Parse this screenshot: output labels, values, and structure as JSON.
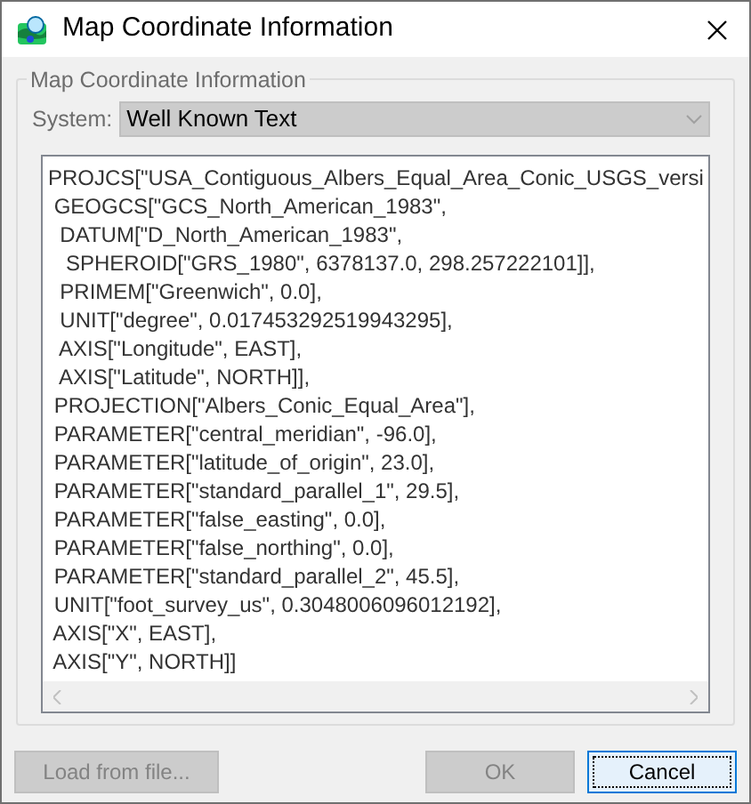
{
  "window": {
    "title": "Map Coordinate Information"
  },
  "group": {
    "title": "Map Coordinate Information"
  },
  "system": {
    "label": "System:",
    "value": "Well Known Text",
    "disabled": true
  },
  "text_lines": [
    "PROJCS[\"USA_Contiguous_Albers_Equal_Area_Conic_USGS_versi",
    " GEOGCS[\"GCS_North_American_1983\",",
    "  DATUM[\"D_North_American_1983\",",
    "   SPHEROID[\"GRS_1980\", 6378137.0, 298.257222101]],",
    "  PRIMEM[\"Greenwich\", 0.0],",
    "  UNIT[\"degree\", 0.017453292519943295],",
    "  AXIS[\"Longitude\", EAST],",
    "  AXIS[\"Latitude\", NORTH]],",
    " PROJECTION[\"Albers_Conic_Equal_Area\"],",
    " PARAMETER[\"central_meridian\", -96.0],",
    " PARAMETER[\"latitude_of_origin\", 23.0],",
    " PARAMETER[\"standard_parallel_1\", 29.5],",
    " PARAMETER[\"false_easting\", 0.0],",
    " PARAMETER[\"false_northing\", 0.0],",
    " PARAMETER[\"standard_parallel_2\", 45.5],",
    " UNIT[\"foot_survey_us\", 0.3048006096012192],",
    " AXIS[\"X\", EAST],",
    " AXIS[\"Y\", NORTH]]"
  ],
  "buttons": [
    {
      "label": "Load from file...",
      "disabled": true,
      "focused": false
    },
    {
      "label": "OK",
      "disabled": true,
      "focused": false
    },
    {
      "label": "Cancel",
      "disabled": false,
      "focused": true
    }
  ]
}
